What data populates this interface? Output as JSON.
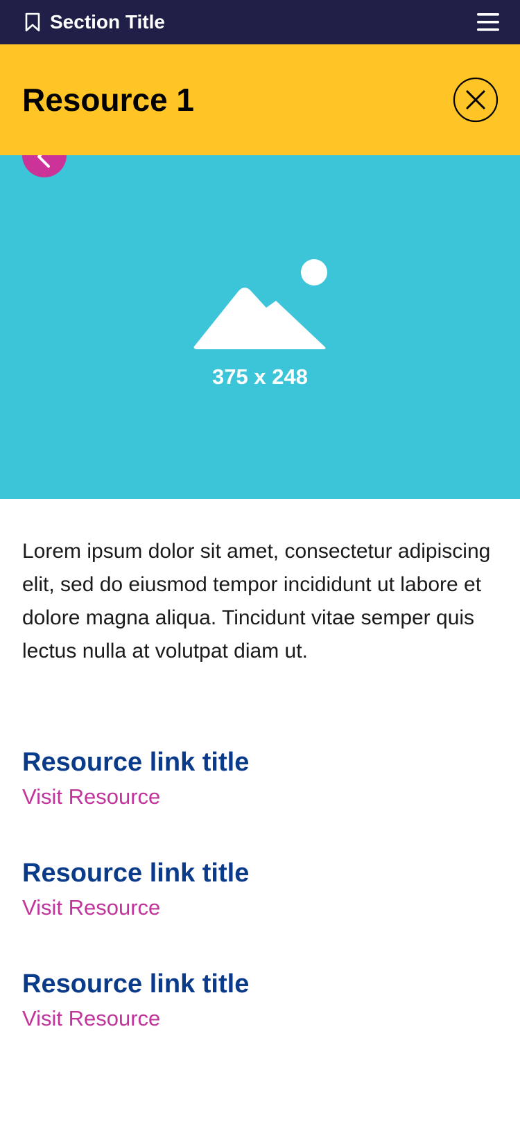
{
  "topbar": {
    "section_title": "Section Title",
    "bookmark_icon": "bookmark-icon",
    "menu_icon": "hamburger-menu-icon"
  },
  "header": {
    "title": "Resource 1",
    "close_icon": "close-icon"
  },
  "hero": {
    "dimensions_label": "375 x 248",
    "image_icon": "image-placeholder-icon",
    "back_icon": "arrow-left-icon"
  },
  "content": {
    "body": "Lorem ipsum dolor sit amet, consectetur adipiscing elit, sed do eiusmod tempor incididunt ut labore et dolore magna aliqua. Tincidunt vitae semper quis lectus nulla at volutpat diam ut."
  },
  "resources": [
    {
      "title": "Resource link title",
      "link": "Visit Resource"
    },
    {
      "title": "Resource link title",
      "link": "Visit Resource"
    },
    {
      "title": "Resource link title",
      "link": "Visit Resource"
    }
  ],
  "colors": {
    "topbar_bg": "#1f1f47",
    "header_bg": "#ffc425",
    "hero_bg": "#3cc5d8",
    "accent": "#cc3399",
    "link_title": "#0a3a8a"
  }
}
